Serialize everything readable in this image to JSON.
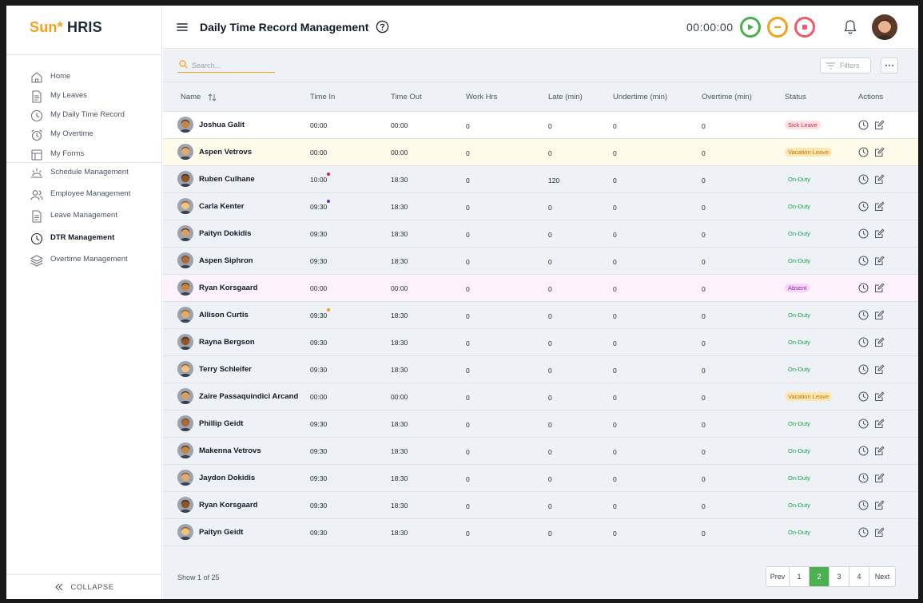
{
  "app": {
    "logo_accent": "Sun*",
    "logo_rest": "HRIS"
  },
  "sidebar": {
    "items_top": [
      {
        "label": "Home",
        "icon": "home-icon"
      },
      {
        "label": "My Leaves",
        "icon": "document-icon"
      },
      {
        "label": "My Daily Time Record",
        "icon": "clock-icon"
      },
      {
        "label": "My Overtime",
        "icon": "alarm-clock-icon"
      },
      {
        "label": "My Forms",
        "icon": "form-icon"
      }
    ],
    "items_admin": [
      {
        "label": "Schedule Management",
        "icon": "sunrise-icon"
      },
      {
        "label": "Employee Management",
        "icon": "users-icon"
      },
      {
        "label": "Leave Management",
        "icon": "document-icon"
      },
      {
        "label": "DTR Management",
        "icon": "clock-icon",
        "active": true
      },
      {
        "label": "Overtime Management",
        "icon": "layers-icon"
      }
    ],
    "collapse_label": "COLLAPSE"
  },
  "header": {
    "title": "Daily Time Record Management",
    "timer": "00:00:00"
  },
  "toolbar": {
    "search_placeholder": "Search...",
    "filters_label": "Filters"
  },
  "table": {
    "columns": [
      "Name",
      "Time In",
      "Time Out",
      "Work Hrs",
      "Late (min)",
      "Undertime (min)",
      "Overtime (min)",
      "Status",
      "Actions"
    ],
    "rows": [
      {
        "name": "Joshua Galit",
        "time_in": "00:00",
        "time_out": "00:00",
        "work_hrs": "0",
        "late": "0",
        "undertime": "0",
        "overtime": "0",
        "status": "Sick Leave",
        "status_type": "sick",
        "highlight": "white"
      },
      {
        "name": "Aspen Vetrovs",
        "time_in": "00:00",
        "time_out": "00:00",
        "work_hrs": "0",
        "late": "0",
        "undertime": "0",
        "overtime": "0",
        "status": "Vacation Leave",
        "status_type": "vacation",
        "highlight": "yellow"
      },
      {
        "name": "Ruben Culhane",
        "time_in": "10:00",
        "time_out": "18:30",
        "work_hrs": "0",
        "late": "120",
        "undertime": "0",
        "overtime": "0",
        "status": "On-Duty",
        "status_type": "onduty",
        "dot": "#e11d48"
      },
      {
        "name": "Carla Kenter",
        "time_in": "09:30",
        "time_out": "18:30",
        "work_hrs": "0",
        "late": "0",
        "undertime": "0",
        "overtime": "0",
        "status": "On-Duty",
        "status_type": "onduty",
        "dot": "#6d28d9"
      },
      {
        "name": "Paityn Dokidis",
        "time_in": "09:30",
        "time_out": "18:30",
        "work_hrs": "0",
        "late": "0",
        "undertime": "0",
        "overtime": "0",
        "status": "On-Duty",
        "status_type": "onduty"
      },
      {
        "name": "Aspen Siphron",
        "time_in": "09:30",
        "time_out": "18:30",
        "work_hrs": "0",
        "late": "0",
        "undertime": "0",
        "overtime": "0",
        "status": "On-Duty",
        "status_type": "onduty"
      },
      {
        "name": "Ryan Korsgaard",
        "time_in": "00:00",
        "time_out": "00:00",
        "work_hrs": "0",
        "late": "0",
        "undertime": "0",
        "overtime": "0",
        "status": "Absent",
        "status_type": "absent",
        "highlight": "pink"
      },
      {
        "name": "Allison Curtis",
        "time_in": "09:30",
        "time_out": "18:30",
        "work_hrs": "0",
        "late": "0",
        "undertime": "0",
        "overtime": "0",
        "status": "On-Duty",
        "status_type": "onduty",
        "dot": "#f59e0b"
      },
      {
        "name": "Rayna Bergson",
        "time_in": "09:30",
        "time_out": "18:30",
        "work_hrs": "0",
        "late": "0",
        "undertime": "0",
        "overtime": "0",
        "status": "On-Duty",
        "status_type": "onduty"
      },
      {
        "name": "Terry Schleifer",
        "time_in": "09:30",
        "time_out": "18:30",
        "work_hrs": "0",
        "late": "0",
        "undertime": "0",
        "overtime": "0",
        "status": "On-Duty",
        "status_type": "onduty"
      },
      {
        "name": "Zaire Passaquindici Arcand",
        "time_in": "00:00",
        "time_out": "00:00",
        "work_hrs": "0",
        "late": "0",
        "undertime": "0",
        "overtime": "0",
        "status": "Vacation Leave",
        "status_type": "vacation"
      },
      {
        "name": "Phillip Geidt",
        "time_in": "09:30",
        "time_out": "18:30",
        "work_hrs": "0",
        "late": "0",
        "undertime": "0",
        "overtime": "0",
        "status": "On-Duty",
        "status_type": "onduty"
      },
      {
        "name": "Makenna Vetrovs",
        "time_in": "09:30",
        "time_out": "18:30",
        "work_hrs": "0",
        "late": "0",
        "undertime": "0",
        "overtime": "0",
        "status": "On-Duty",
        "status_type": "onduty"
      },
      {
        "name": "Jaydon Dokidis",
        "time_in": "09:30",
        "time_out": "18:30",
        "work_hrs": "0",
        "late": "0",
        "undertime": "0",
        "overtime": "0",
        "status": "On-Duty",
        "status_type": "onduty"
      },
      {
        "name": "Ryan Korsgaard",
        "time_in": "09:30",
        "time_out": "18:30",
        "work_hrs": "0",
        "late": "0",
        "undertime": "0",
        "overtime": "0",
        "status": "On-Duty",
        "status_type": "onduty"
      },
      {
        "name": "Paityn Geidt",
        "time_in": "09:30",
        "time_out": "18:30",
        "work_hrs": "0",
        "late": "0",
        "undertime": "0",
        "overtime": "0",
        "status": "On-Duty",
        "status_type": "onduty"
      }
    ]
  },
  "footer": {
    "info": "Show 1 of 25",
    "pages": [
      "Prev",
      "1",
      "2",
      "3",
      "4",
      "Next"
    ],
    "active_page": "2"
  },
  "colors": {
    "accent": "#f5a11c",
    "play": "#4caf50",
    "pause": "#f5a11c",
    "stop": "#ef5b6b",
    "onduty_text": "#16a34a",
    "sick_bg": "#fde2e4",
    "sick_text": "#e11d48",
    "vacation_bg": "#fde7b0",
    "vacation_text": "#c2700a",
    "absent_bg": "#f3d9f5",
    "absent_text": "#a21caf",
    "row_yellow": "#fffbea",
    "row_pink": "#fdf2fc",
    "row_white": "#ffffff"
  }
}
